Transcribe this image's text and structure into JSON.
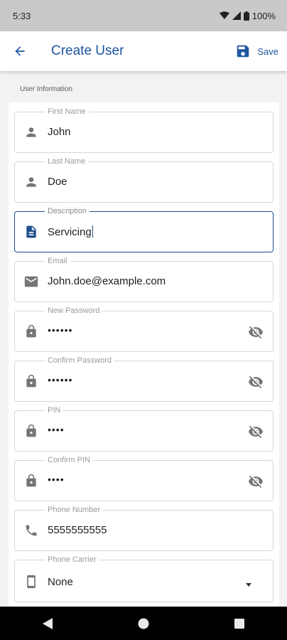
{
  "status_bar": {
    "time": "5:33",
    "battery": "100%"
  },
  "app_bar": {
    "title": "Create User",
    "save_label": "Save"
  },
  "section": {
    "label": "User Information"
  },
  "fields": {
    "first_name": {
      "label": "First Name",
      "value": "John"
    },
    "last_name": {
      "label": "Last Name",
      "value": "Doe"
    },
    "description": {
      "label": "Description",
      "value": "Servicing"
    },
    "email": {
      "label": "Email",
      "value": "John.doe@example.com"
    },
    "new_password": {
      "label": "New Password",
      "value": "••••••"
    },
    "confirm_password": {
      "label": "Confirm Password",
      "value": "••••••"
    },
    "pin": {
      "label": "PIN",
      "value": "••••"
    },
    "confirm_pin": {
      "label": "Confirm PIN",
      "value": "••••"
    },
    "phone_number": {
      "label": "Phone Number",
      "value": "5555555555"
    },
    "phone_carrier": {
      "label": "Phone Carrier",
      "value": "None"
    }
  },
  "icons": {
    "back": "arrow-back-icon",
    "save": "save-icon",
    "person": "person-icon",
    "description": "description-icon",
    "email": "mail-icon",
    "lock": "lock-icon",
    "visibility_off": "visibility-off-icon",
    "phone": "phone-icon",
    "smartphone": "smartphone-icon",
    "dropdown": "dropdown-arrow-icon"
  },
  "colors": {
    "accent": "#1f56a2",
    "focused_border": "#1f4e8c",
    "status_bar": "#c9c9c9",
    "nav_bar": "#000000"
  }
}
